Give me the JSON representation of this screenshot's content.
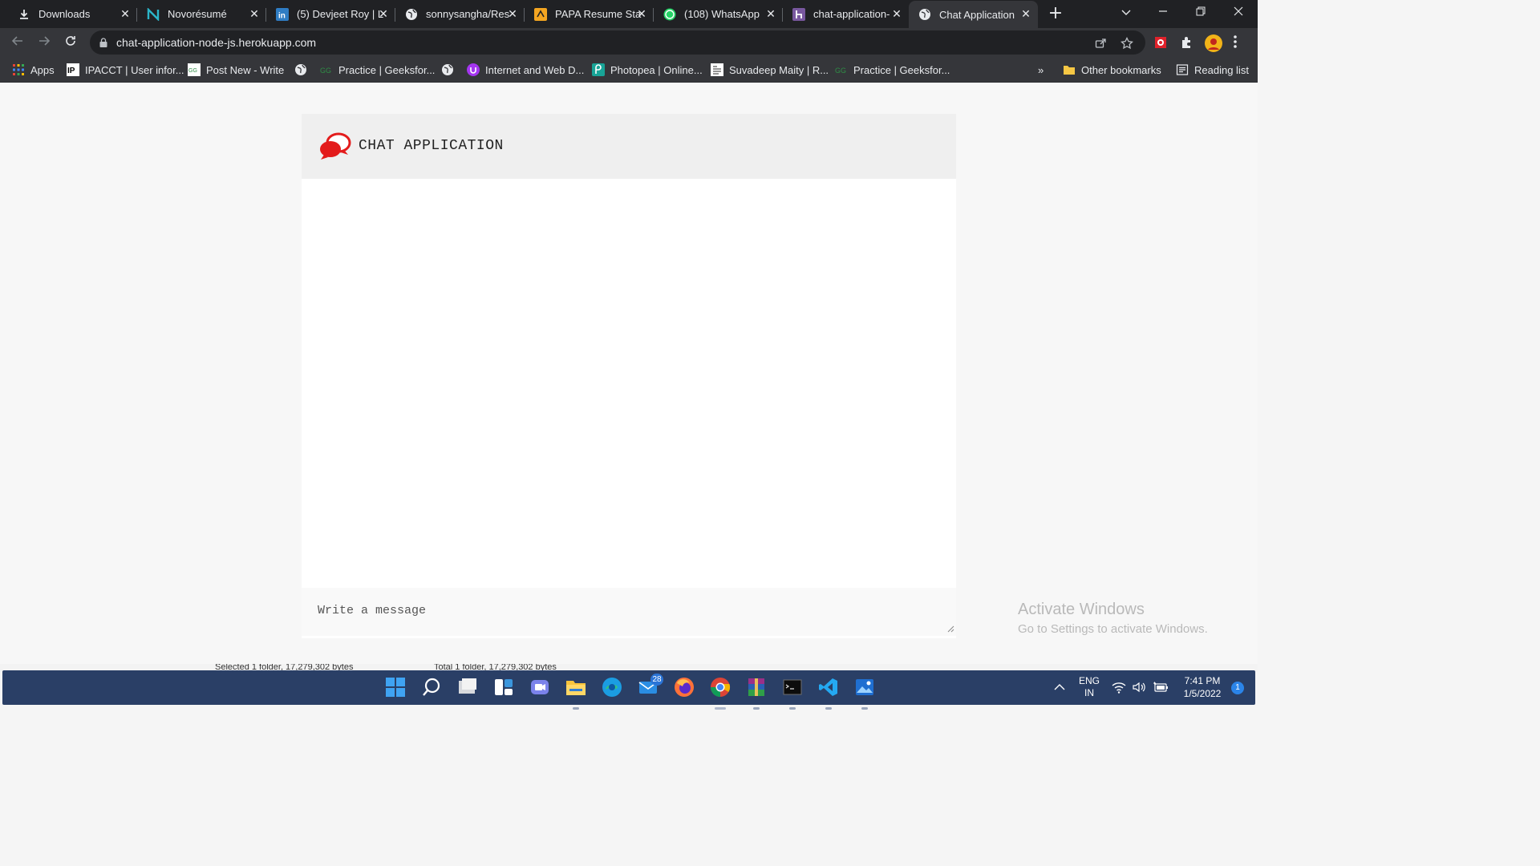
{
  "browser": {
    "tabs": [
      {
        "title": "Downloads",
        "icon": "download-icon"
      },
      {
        "title": "Novorésumé",
        "icon": "novoresume-icon"
      },
      {
        "title": "(5) Devjeet Roy | L",
        "icon": "linkedin-icon"
      },
      {
        "title": "sonnysangha/Res",
        "icon": "globe-icon"
      },
      {
        "title": "PAPA Resume Sta",
        "icon": "papa-icon"
      },
      {
        "title": "(108) WhatsApp",
        "icon": "whatsapp-icon"
      },
      {
        "title": "chat-application-",
        "icon": "heroku-icon"
      },
      {
        "title": "Chat Application",
        "icon": "globe-icon"
      }
    ],
    "active_tab_index": 7,
    "url": "chat-application-node-js.herokuapp.com",
    "bookmarks": [
      {
        "label": "Apps",
        "icon": "apps-grid-icon"
      },
      {
        "label": "IPACCT | User infor...",
        "icon": "ipacct-icon"
      },
      {
        "label": "Post New - Write",
        "icon": "gfg-write-icon"
      },
      {
        "label": "",
        "icon": "globe-icon"
      },
      {
        "label": "Practice | Geeksfor...",
        "icon": "gfg-icon"
      },
      {
        "label": "",
        "icon": "globe-icon"
      },
      {
        "label": "Internet and Web D...",
        "icon": "udemy-icon"
      },
      {
        "label": "Photopea | Online...",
        "icon": "photopea-icon"
      },
      {
        "label": "Suvadeep Maity | R...",
        "icon": "resume-icon"
      },
      {
        "label": "Practice | Geeksfor...",
        "icon": "gfg-icon"
      }
    ],
    "bookmarks_overflow": "»",
    "other_bookmarks": "Other bookmarks",
    "reading_list": "Reading list"
  },
  "chat": {
    "title": "CHAT APPLICATION",
    "input_placeholder": "Write a message"
  },
  "watermark": {
    "line1": "Activate Windows",
    "line2": "Go to Settings to activate Windows."
  },
  "explorer_status": {
    "left": "Selected 1 folder, 17,279,302 bytes",
    "right": "Total 1 folder, 17,279,302 bytes"
  },
  "taskbar": {
    "apps": [
      "start-icon",
      "search-icon",
      "task-view-icon",
      "widgets-icon",
      "teams-chat-icon",
      "file-explorer-icon",
      "edge-icon",
      "mail-icon",
      "firefox-icon",
      "chrome-icon",
      "winrar-icon",
      "terminal-icon",
      "vscode-icon",
      "photos-icon"
    ],
    "mail_badge": "28",
    "language_line1": "ENG",
    "language_line2": "IN",
    "time": "7:41 PM",
    "date": "1/5/2022",
    "notification_count": "1"
  },
  "colors": {
    "tab_bar": "#202124",
    "toolbar": "#35363a",
    "chat_logo_red": "#e31b1b",
    "taskbar": "#2a3f66"
  }
}
